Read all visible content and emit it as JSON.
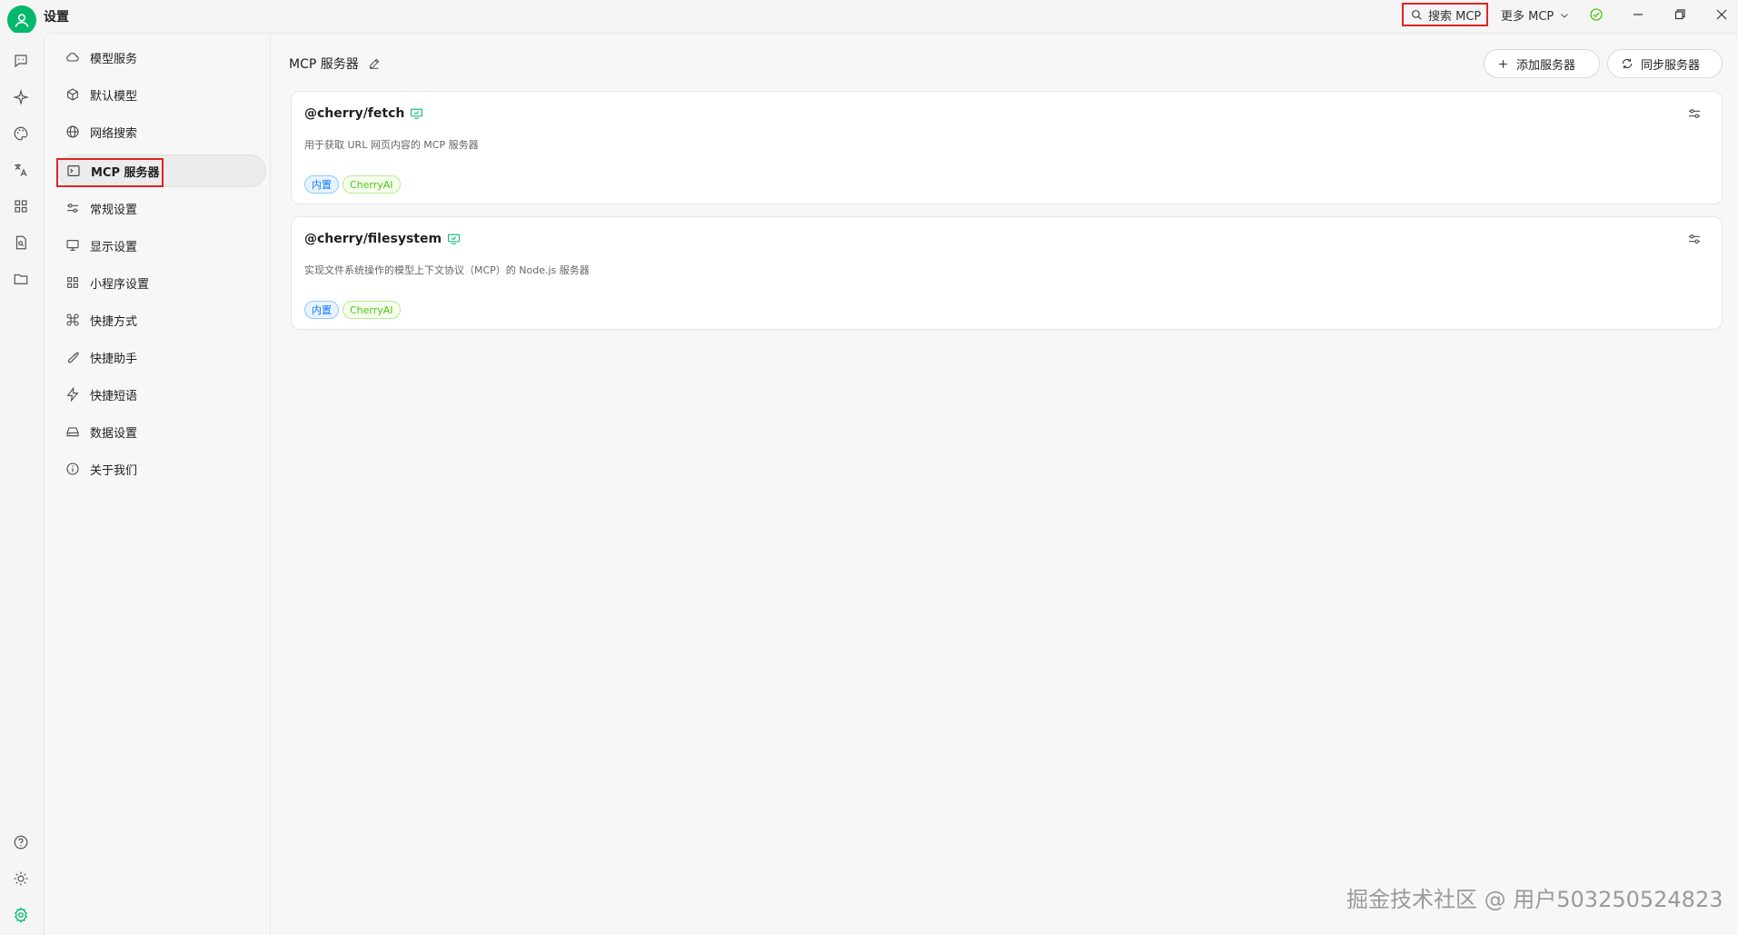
{
  "window": {
    "title": "设置",
    "search_label": "搜索 MCP",
    "more_label": "更多 MCP"
  },
  "sidebar": {
    "items": [
      {
        "label": "模型服务",
        "icon": "cloud-icon"
      },
      {
        "label": "默认模型",
        "icon": "cube-icon"
      },
      {
        "label": "网络搜索",
        "icon": "globe-icon"
      },
      {
        "label": "MCP 服务器",
        "icon": "terminal-icon"
      },
      {
        "label": "常规设置",
        "icon": "sliders-icon"
      },
      {
        "label": "显示设置",
        "icon": "monitor-icon"
      },
      {
        "label": "小程序设置",
        "icon": "grid-icon"
      },
      {
        "label": "快捷方式",
        "icon": "command-icon"
      },
      {
        "label": "快捷助手",
        "icon": "rocket-icon"
      },
      {
        "label": "快捷短语",
        "icon": "zap-icon"
      },
      {
        "label": "数据设置",
        "icon": "harddrive-icon"
      },
      {
        "label": "关于我们",
        "icon": "info-icon"
      }
    ],
    "active_index": 3
  },
  "main": {
    "title": "MCP 服务器",
    "add_button": "添加服务器",
    "sync_button": "同步服务器",
    "servers": [
      {
        "name": "@cherry/fetch",
        "description": "用于获取 URL 网页内容的 MCP 服务器",
        "tags": [
          "内置",
          "CherryAI"
        ]
      },
      {
        "name": "@cherry/filesystem",
        "description": "实现文件系统操作的模型上下文协议（MCP）的 Node.js 服务器",
        "tags": [
          "内置",
          "CherryAI"
        ]
      }
    ]
  },
  "watermark": "掘金技术社区 @ 用户503250524823",
  "colors": {
    "accent": "#00b96b",
    "highlight_outline": "#e02424",
    "tag_builtin": "#1677ff",
    "tag_vendor": "#52c41a"
  }
}
